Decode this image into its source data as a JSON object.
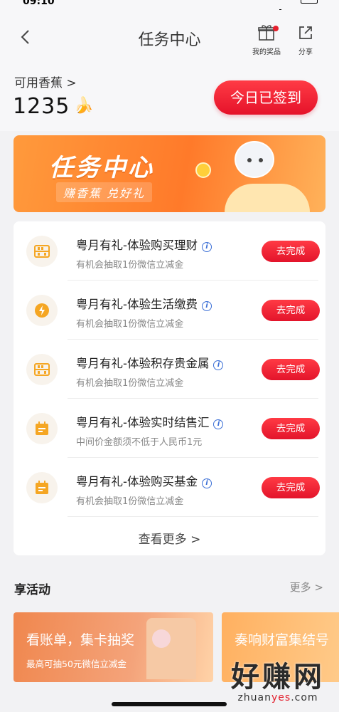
{
  "status_bar": {
    "time": "09:10"
  },
  "header": {
    "title": "任务中心",
    "my_prizes": "我的奖品",
    "share": "分享"
  },
  "balance": {
    "label": "可用香蕉 >",
    "value": "1235",
    "emoji": "🍌"
  },
  "sign_button": "今日已签到",
  "banner": {
    "title": "任务中心",
    "subtitle": "赚香蕉 兑好礼"
  },
  "tasks": [
    {
      "title": "粤月有礼-体验购买理财",
      "sub": "有机会抽取1份微信立减金",
      "button": "去完成",
      "icon": "abacus-icon"
    },
    {
      "title": "粤月有礼-体验生活缴费",
      "sub": "有机会抽取1份微信立减金",
      "button": "去完成",
      "icon": "lightning-icon"
    },
    {
      "title": "粤月有礼-体验积存贵金属",
      "sub": "有机会抽取1份微信立减金",
      "button": "去完成",
      "icon": "abacus-icon"
    },
    {
      "title": "粤月有礼-体验实时结售汇",
      "sub": "中间价金额须不低于人民币1元",
      "button": "去完成",
      "icon": "calendar-icon"
    },
    {
      "title": "粤月有礼-体验购买基金",
      "sub": "有机会抽取1份微信立减金",
      "button": "去完成",
      "icon": "calendar-icon"
    }
  ],
  "see_more": "查看更多 >",
  "activities": {
    "title": "享活动",
    "more": "更多 >",
    "promos": [
      {
        "title": "看账单，集卡抽奖",
        "sub": "最高可抽50元微信立减金"
      },
      {
        "title": "奏响财富集结号",
        "sub": ""
      }
    ]
  },
  "watermark": {
    "main": "好赚网",
    "url_prefix": "zhuan",
    "url_highlight": "yes",
    "url_suffix": ".com"
  },
  "colors": {
    "accent_red": "#e5122a",
    "icon_orange": "#f5a623",
    "banner_orange": "#ff7a2a"
  }
}
